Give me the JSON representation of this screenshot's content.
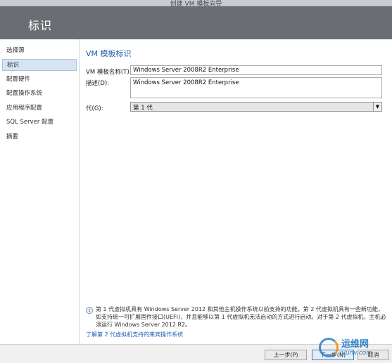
{
  "window": {
    "title": "创建 VM 模板向导"
  },
  "header": {
    "title": "标识"
  },
  "sidebar": {
    "items": [
      {
        "label": "选择源"
      },
      {
        "label": "标识"
      },
      {
        "label": "配置硬件"
      },
      {
        "label": "配置操作系统"
      },
      {
        "label": "应用程序配置"
      },
      {
        "label": "SQL Server 配置"
      },
      {
        "label": "摘要"
      }
    ],
    "active_index": 1
  },
  "main": {
    "section_title": "VM 模板标识",
    "name_label": "VM 模板名称(T):",
    "name_value": "Windows Server 2008R2 Enterprise",
    "desc_label": "描述(D):",
    "desc_value": "Windows Server 2008R2 Enterprise",
    "gen_label": "代(G):",
    "gen_value": "第 1 代"
  },
  "info": {
    "text": "第 1 代虚拟机具有 Windows Server 2012 和其他主机操作系统以前支持的功能。第 2 代虚拟机具有一些新功能，如支持统一可扩展固件接口(UEFI)，并且能够以第 1 代虚拟机无法启动的方式进行启动。对于第 2 代虚拟机，主机必须运行 Windows Server 2012 R2。",
    "link": "了解第 2 代虚拟机支持的来宾操作系统"
  },
  "footer": {
    "prev_label": "上一步(P)",
    "next_label": "下一步(N)",
    "cancel_label": "取消"
  },
  "watermark": {
    "text": "运维网",
    "sub": "iyunv.com"
  },
  "colors": {
    "header_bg": "#6a6d72",
    "accent": "#1f5fa8",
    "selected": "#d6e4f3"
  }
}
